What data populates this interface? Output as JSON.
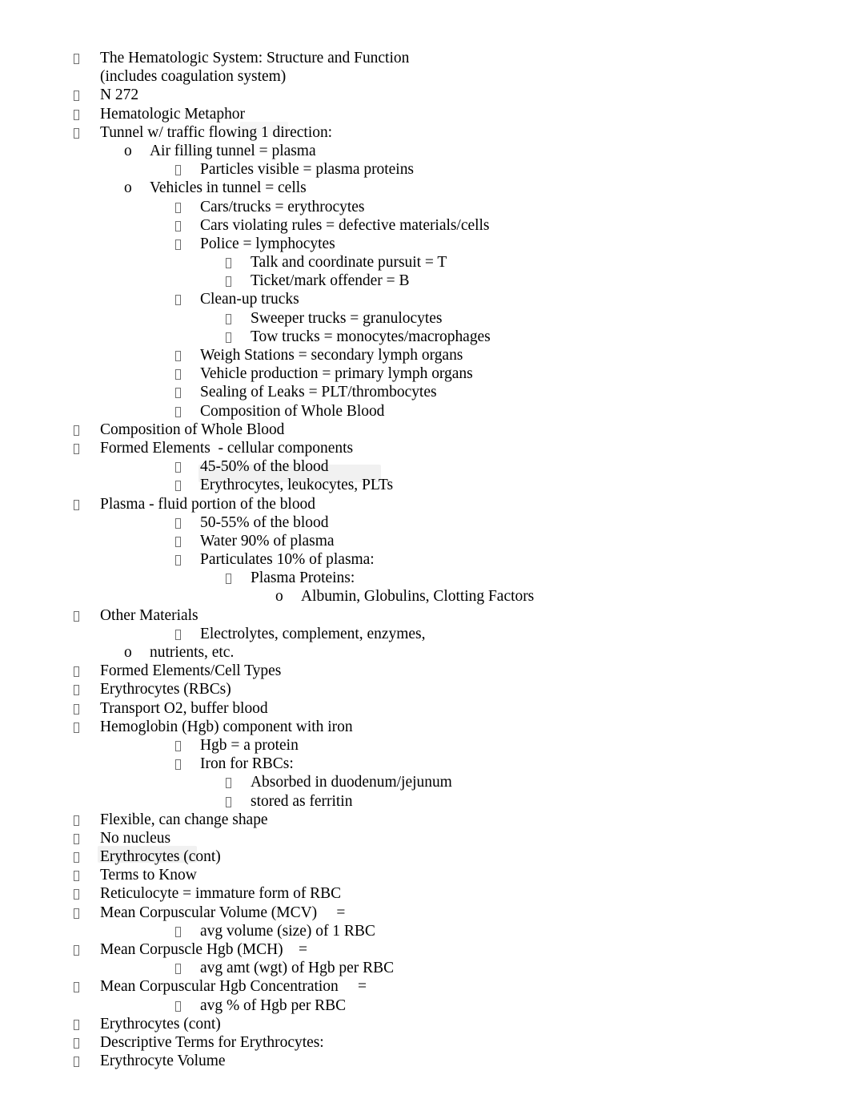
{
  "document": {
    "background_color": "#ffffff",
    "text_color": "#000000",
    "highlight_color": "#eeeeee",
    "bullet_glyph_name": "missing-glyph-box",
    "sublist_marker": "o"
  },
  "outline": [
    {
      "level": 1,
      "marker": "box",
      "text": "The Hematologic System: Structure and Function"
    },
    {
      "level": 1,
      "marker": "none",
      "text": "(includes coagulation system)"
    },
    {
      "level": 1,
      "marker": "box",
      "text": "N 272"
    },
    {
      "level": 1,
      "marker": "box",
      "text": "Hematologic Metaphor"
    },
    {
      "level": 1,
      "marker": "box",
      "text": "Tunnel w/ traffic flowing 1 direction:"
    },
    {
      "level": 2,
      "marker": "o",
      "text": "Air filling tunnel = plasma"
    },
    {
      "level": 3,
      "marker": "box",
      "text": "Particles visible = plasma proteins"
    },
    {
      "level": 2,
      "marker": "o",
      "text": "Vehicles in tunnel = cells"
    },
    {
      "level": 3,
      "marker": "box",
      "text": "Cars/trucks = erythrocytes"
    },
    {
      "level": 3,
      "marker": "box",
      "text": "Cars violating rules = defective materials/cells"
    },
    {
      "level": 3,
      "marker": "box",
      "text": "Police = lymphocytes"
    },
    {
      "level": 4,
      "marker": "box",
      "text": "Talk and coordinate pursuit = T"
    },
    {
      "level": 4,
      "marker": "box",
      "text": "Ticket/mark offender = B"
    },
    {
      "level": 3,
      "marker": "box",
      "text": "Clean-up trucks"
    },
    {
      "level": 4,
      "marker": "box",
      "text": "Sweeper trucks = granulocytes"
    },
    {
      "level": 4,
      "marker": "box",
      "text": "Tow trucks = monocytes/macrophages"
    },
    {
      "level": 3,
      "marker": "box",
      "text": "Weigh Stations = secondary lymph organs"
    },
    {
      "level": 3,
      "marker": "box",
      "text": "Vehicle production = primary lymph organs"
    },
    {
      "level": 3,
      "marker": "box",
      "text": "Sealing of Leaks = PLT/thrombocytes"
    },
    {
      "level": 3,
      "marker": "box",
      "text": "Composition of Whole Blood"
    },
    {
      "level": 1,
      "marker": "box",
      "text": "Composition of Whole Blood"
    },
    {
      "level": 1,
      "marker": "box",
      "text": "Formed Elements  - cellular components"
    },
    {
      "level": 3,
      "marker": "box",
      "text": "45-50% of the blood"
    },
    {
      "level": 3,
      "marker": "box",
      "text": "Erythrocytes, leukocytes, PLTs"
    },
    {
      "level": 1,
      "marker": "box",
      "text": "Plasma - fluid portion of the blood"
    },
    {
      "level": 3,
      "marker": "box",
      "text": "50-55% of the blood"
    },
    {
      "level": 3,
      "marker": "box",
      "text": "Water 90% of plasma"
    },
    {
      "level": 3,
      "marker": "box",
      "text": "Particulates 10% of plasma:"
    },
    {
      "level": 4,
      "marker": "box",
      "text": "Plasma Proteins:"
    },
    {
      "level": 5,
      "marker": "o",
      "text": "Albumin, Globulins, Clotting Factors"
    },
    {
      "level": 1,
      "marker": "box",
      "text": "Other Materials"
    },
    {
      "level": 3,
      "marker": "box",
      "text": "Electrolytes, complement, enzymes,"
    },
    {
      "level": 2,
      "marker": "o",
      "text": "nutrients, etc."
    },
    {
      "level": 1,
      "marker": "box",
      "text": "Formed Elements/Cell Types"
    },
    {
      "level": 1,
      "marker": "box",
      "text": "Erythrocytes (RBCs)"
    },
    {
      "level": 1,
      "marker": "box",
      "text": "Transport O2, buffer blood"
    },
    {
      "level": 1,
      "marker": "box",
      "text": "Hemoglobin (Hgb) component with iron"
    },
    {
      "level": 3,
      "marker": "box",
      "text": "Hgb = a protein"
    },
    {
      "level": 3,
      "marker": "box",
      "text": "Iron for RBCs:"
    },
    {
      "level": 4,
      "marker": "box",
      "text": "Absorbed in duodenum/jejunum"
    },
    {
      "level": 4,
      "marker": "box",
      "text": "stored as ferritin"
    },
    {
      "level": 1,
      "marker": "box",
      "text": "Flexible, can change shape"
    },
    {
      "level": 1,
      "marker": "box",
      "text": "No nucleus"
    },
    {
      "level": 1,
      "marker": "box",
      "text": "Erythrocytes (cont)"
    },
    {
      "level": 1,
      "marker": "box",
      "text": "Terms to Know"
    },
    {
      "level": 1,
      "marker": "box",
      "text": "Reticulocyte = immature form of RBC"
    },
    {
      "level": 1,
      "marker": "box",
      "text": "Mean Corpuscular Volume (MCV)     ="
    },
    {
      "level": 3,
      "marker": "box",
      "text": "avg volume (size) of 1 RBC"
    },
    {
      "level": 1,
      "marker": "box",
      "text": "Mean Corpuscle Hgb (MCH)    ="
    },
    {
      "level": 3,
      "marker": "box",
      "text": "avg amt (wgt) of Hgb per RBC"
    },
    {
      "level": 1,
      "marker": "box",
      "text": "Mean Corpuscular Hgb Concentration     ="
    },
    {
      "level": 3,
      "marker": "box",
      "text": "avg % of Hgb per RBC"
    },
    {
      "level": 1,
      "marker": "box",
      "text": "Erythrocytes (cont)"
    },
    {
      "level": 1,
      "marker": "box",
      "text": "Descriptive Terms for Erythrocytes:"
    },
    {
      "level": 1,
      "marker": "box",
      "text": "Erythrocyte Volume"
    }
  ]
}
